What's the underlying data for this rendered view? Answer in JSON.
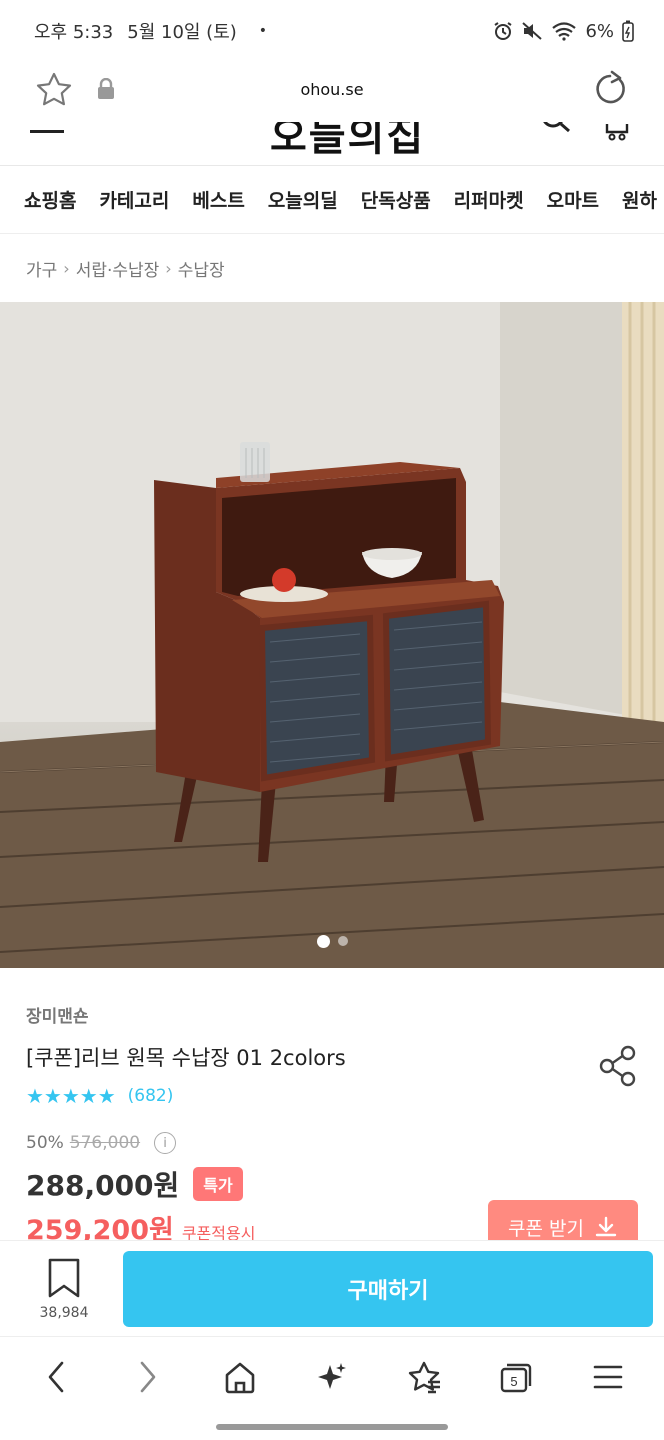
{
  "status_bar": {
    "time": "오후 5:33",
    "date": "5월 10일 (토)",
    "dot": "•",
    "battery": "6%"
  },
  "browser": {
    "url": "ohou.se"
  },
  "site_header": {
    "logo": "오늘의집"
  },
  "categories": [
    "쇼핑홈",
    "카테고리",
    "베스트",
    "오늘의딜",
    "단독상품",
    "리퍼마켓",
    "오마트",
    "원하"
  ],
  "breadcrumb": [
    "가구",
    "서랍·수납장",
    "수납장"
  ],
  "product": {
    "brand": "장미맨숀",
    "title": "[쿠폰]리브 원목 수납장 01 2colors",
    "rating_stars": "★★★★★",
    "review_count": "(682)",
    "discount_rate": "50%",
    "original_price": "576,000",
    "price": "288,000원",
    "special_badge": "특가",
    "coupon_price": "259,200원",
    "coupon_note": "쿠폰적용시",
    "coupon_button": "쿠폰 받기",
    "carousel": {
      "total": 2,
      "active": 1
    }
  },
  "action_bar": {
    "bookmark_count": "38,984",
    "buy_label": "구매하기"
  },
  "colors": {
    "accent": "#35c5f0",
    "sale": "#f55f5f",
    "badge": "#ff7777"
  },
  "icons": {
    "browser_nav": [
      "back-icon",
      "forward-icon",
      "home-icon",
      "sparkle-icon",
      "bookmark-star-icon",
      "tabs-icon",
      "menu-icon"
    ],
    "tabs_count": "5"
  }
}
